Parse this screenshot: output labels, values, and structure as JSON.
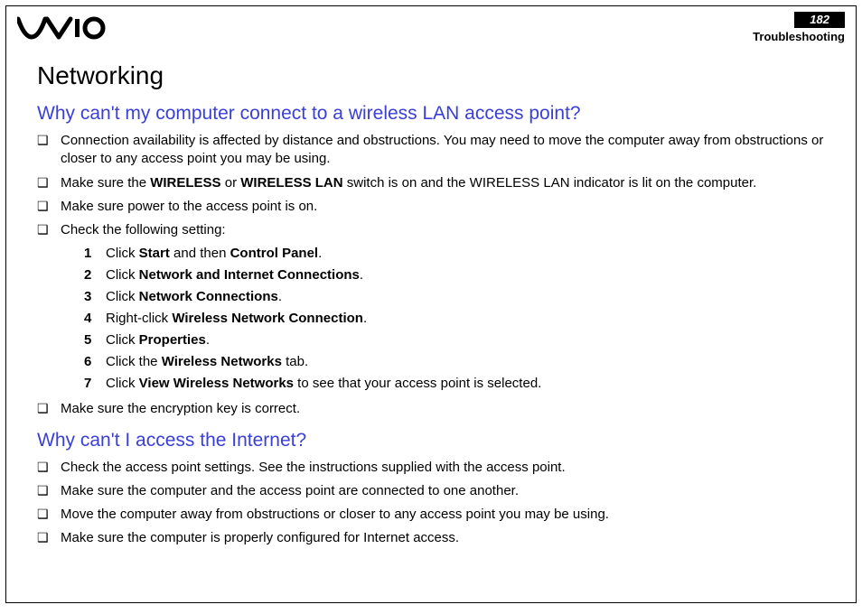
{
  "header": {
    "page_number": "182",
    "section": "Troubleshooting",
    "logo_alt": "VAIO"
  },
  "title": "Networking",
  "q1": {
    "heading": "Why can't my computer connect to a wireless LAN access point?",
    "b1": "Connection availability is affected by distance and obstructions. You may need to move the computer away from obstructions or closer to any access point you may be using.",
    "b2_pre": "Make sure the ",
    "b2_bold1": "WIRELESS",
    "b2_mid": " or ",
    "b2_bold2": "WIRELESS LAN",
    "b2_post": " switch is on and the WIRELESS LAN indicator is lit on the computer.",
    "b3": "Make sure power to the access point is on.",
    "b4": "Check the following setting:",
    "steps": {
      "s1_pre": "Click ",
      "s1_b1": "Start",
      "s1_mid": " and then ",
      "s1_b2": "Control Panel",
      "s1_post": ".",
      "s2_pre": "Click ",
      "s2_b1": "Network and Internet Connections",
      "s2_post": ".",
      "s3_pre": "Click ",
      "s3_b1": "Network Connections",
      "s3_post": ".",
      "s4_pre": "Right-click ",
      "s4_b1": "Wireless Network Connection",
      "s4_post": ".",
      "s5_pre": "Click ",
      "s5_b1": "Properties",
      "s5_post": ".",
      "s6_pre": "Click the ",
      "s6_b1": "Wireless Networks",
      "s6_post": " tab.",
      "s7_pre": "Click ",
      "s7_b1": "View Wireless Networks",
      "s7_post": " to see that your access point is selected."
    },
    "b5": "Make sure the encryption key is correct."
  },
  "q2": {
    "heading": "Why can't I access the Internet?",
    "b1": "Check the access point settings. See the instructions supplied with the access point.",
    "b2": "Make sure the computer and the access point are connected to one another.",
    "b3": "Move the computer away from obstructions or closer to any access point you may be using.",
    "b4": "Make sure the computer is properly configured for Internet access."
  }
}
